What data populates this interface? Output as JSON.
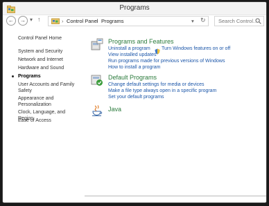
{
  "window": {
    "title": "Programs"
  },
  "nav": {
    "back_glyph": "←",
    "forward_glyph": "→",
    "history_glyph": "▾",
    "up_glyph": "↑",
    "separator": "›",
    "breadcrumb": [
      "Control Panel",
      "Programs"
    ],
    "refresh_glyph": "↻",
    "dropdown_glyph": "▾",
    "search_placeholder": "Search Control..."
  },
  "sidebar": {
    "home": "Control Panel Home",
    "items": [
      "System and Security",
      "Network and Internet",
      "Hardware and Sound",
      "Programs",
      "User Accounts and Family Safety",
      "Appearance and Personalization",
      "Clock, Language, and Region",
      "Ease of Access"
    ],
    "current": "Programs"
  },
  "categories": {
    "programs_features": {
      "title": "Programs and Features",
      "links": [
        "Uninstall a program",
        "Turn Windows features on or off",
        "View installed updates",
        "Run programs made for previous versions of Windows",
        "How to install a program"
      ]
    },
    "default_programs": {
      "title": "Default Programs",
      "links": [
        "Change default settings for media or devices",
        "Make a file type always open in a specific program",
        "Set your default programs"
      ]
    },
    "java": {
      "title": "Java"
    }
  },
  "colors": {
    "accent_green": "#2a7a3b",
    "link_blue": "#1a55a8"
  },
  "icons": [
    "control-panel-icon",
    "back-icon",
    "forward-icon",
    "up-arrow-icon",
    "folder-icon",
    "refresh-icon",
    "search-icon",
    "programs-icon",
    "shield-icon",
    "default-programs-icon",
    "java-icon"
  ]
}
